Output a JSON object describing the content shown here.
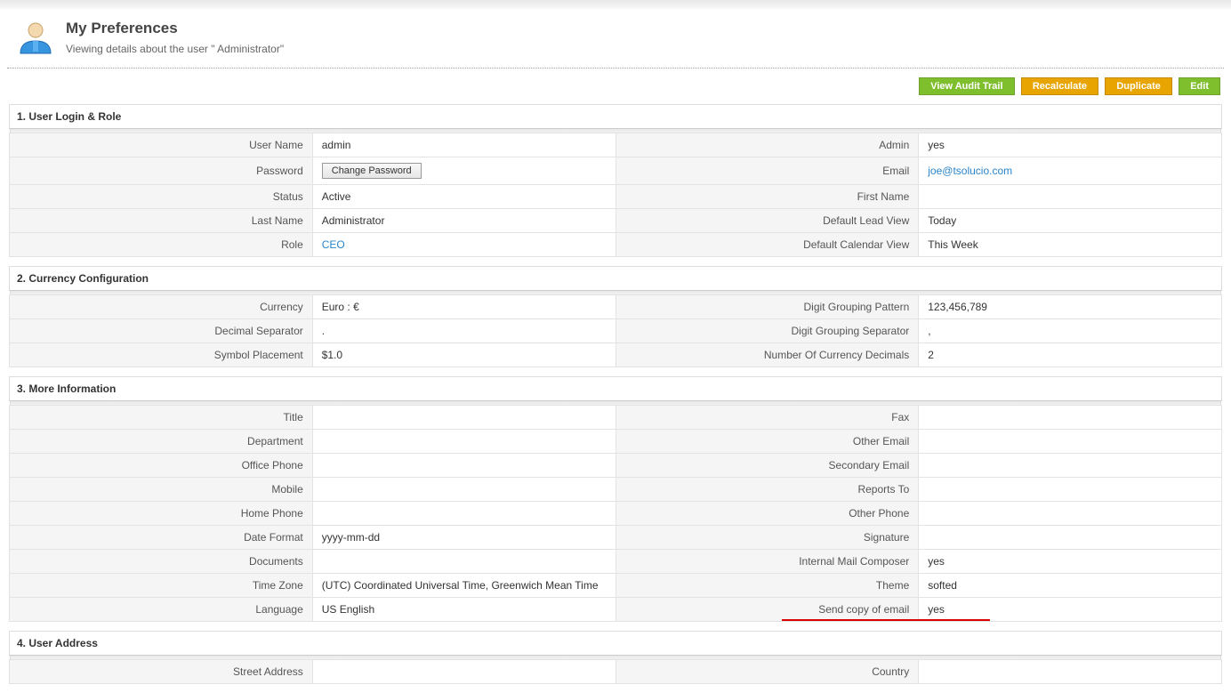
{
  "header": {
    "title": "My Preferences",
    "subtitle": "Viewing details about the user \" Administrator\""
  },
  "actions": {
    "audit": "View Audit Trail",
    "recalc": "Recalculate",
    "dup": "Duplicate",
    "edit": "Edit"
  },
  "sections": {
    "login": {
      "title": "1. User Login & Role",
      "labels": {
        "username": "User Name",
        "admin": "Admin",
        "password": "Password",
        "email": "Email",
        "status": "Status",
        "firstname": "First Name",
        "lastname": "Last Name",
        "leadview": "Default Lead View",
        "role": "Role",
        "calview": "Default Calendar View"
      },
      "values": {
        "username": "admin",
        "admin": "yes",
        "password_btn": "Change Password",
        "email": "joe@tsolucio.com",
        "status": "Active",
        "firstname": "",
        "lastname": " Administrator",
        "leadview": "Today",
        "role": "CEO",
        "calview": "This Week"
      }
    },
    "currency": {
      "title": "2. Currency Configuration",
      "labels": {
        "currency": "Currency",
        "digitgroup": "Digit Grouping Pattern",
        "decimal": "Decimal Separator",
        "groupsep": "Digit Grouping Separator",
        "symbol": "Symbol Placement",
        "decimals": "Number Of Currency Decimals"
      },
      "values": {
        "currency": "Euro : €",
        "digitgroup": "123,456,789",
        "decimal": ".",
        "groupsep": ",",
        "symbol": "$1.0",
        "decimals": "2"
      }
    },
    "more": {
      "title": "3. More Information",
      "labels": {
        "title_f": "Title",
        "fax": "Fax",
        "dept": "Department",
        "otheremail": "Other Email",
        "office": "Office Phone",
        "secemail": "Secondary Email",
        "mobile": "Mobile",
        "reports": "Reports To",
        "home": "Home Phone",
        "otherphone": "Other Phone",
        "dateformat": "Date Format",
        "signature": "Signature",
        "documents": "Documents",
        "mailcomposer": "Internal Mail Composer",
        "tz": "Time Zone",
        "theme": "Theme",
        "lang": "Language",
        "sendcopy": "Send copy of email"
      },
      "values": {
        "title_f": "",
        "fax": "",
        "dept": "",
        "otheremail": "",
        "office": "",
        "secemail": "",
        "mobile": "",
        "reports": "",
        "home": "",
        "otherphone": "",
        "dateformat": "yyyy-mm-dd",
        "signature": "",
        "documents": "",
        "mailcomposer": "yes",
        "tz": "(UTC) Coordinated Universal Time, Greenwich Mean Time",
        "theme": "softed",
        "lang": " US English",
        "sendcopy": "yes"
      }
    },
    "address": {
      "title": "4. User Address",
      "labels": {
        "street": "Street Address",
        "country": "Country"
      },
      "values": {
        "street": "",
        "country": ""
      }
    }
  }
}
